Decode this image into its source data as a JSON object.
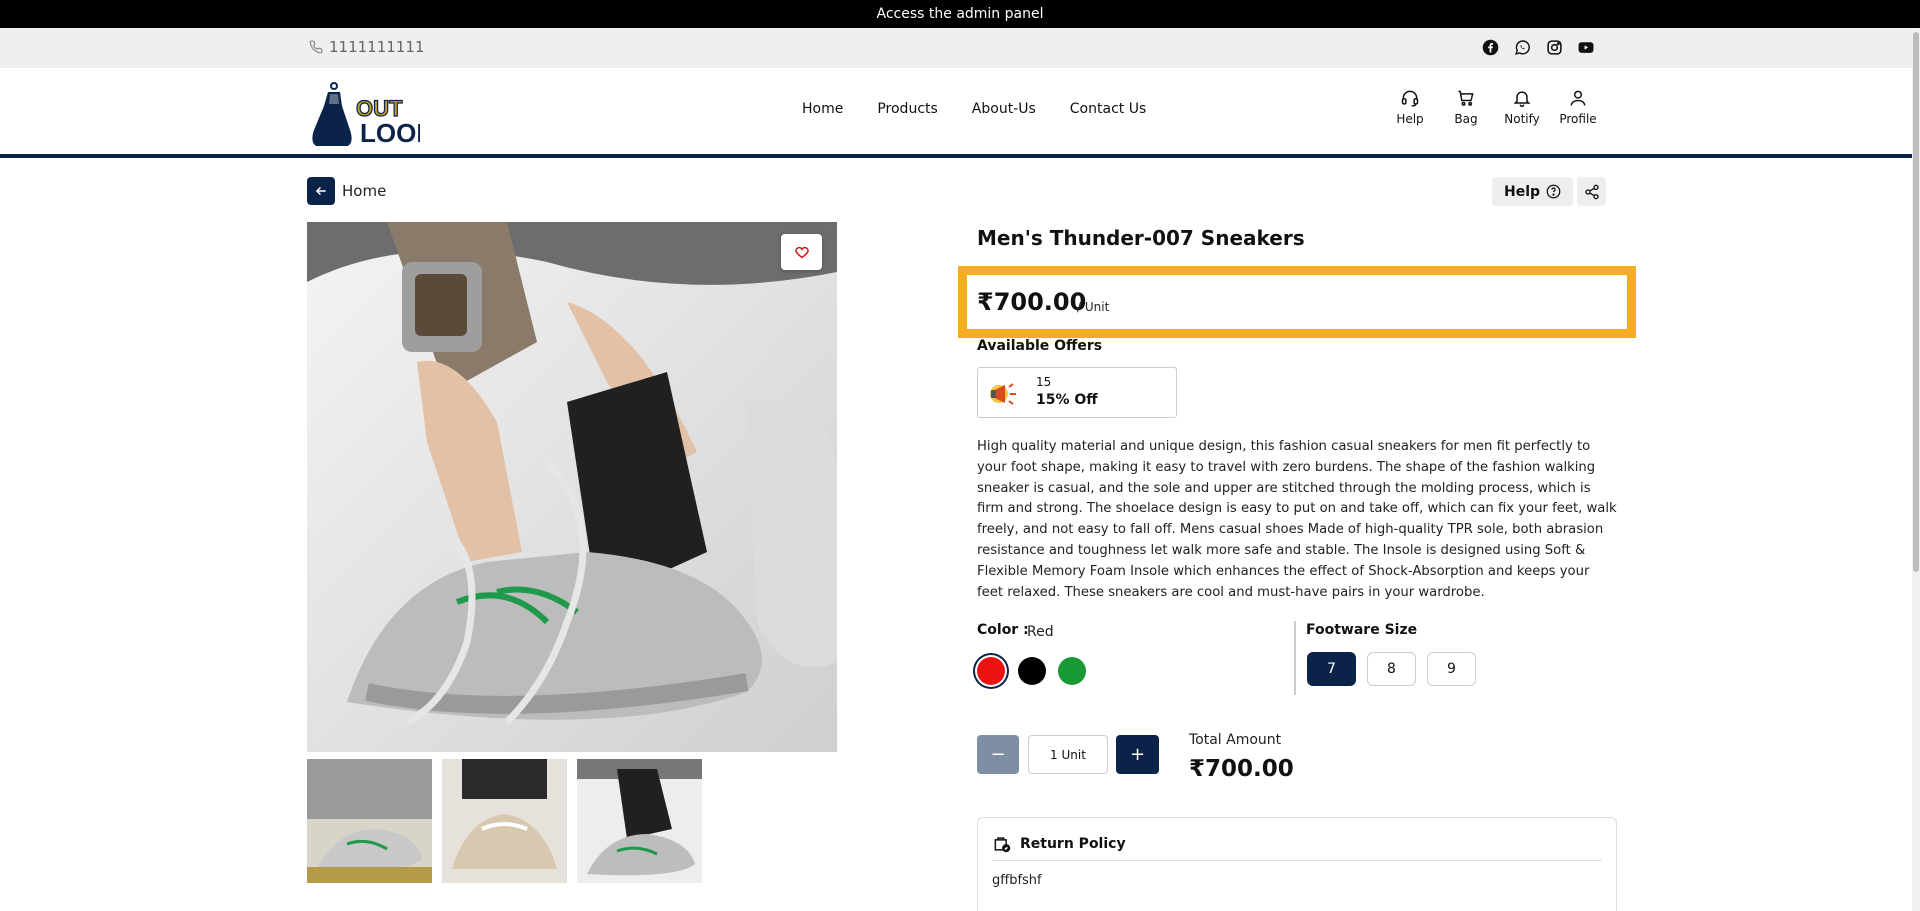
{
  "top_bar": {
    "admin_link": "Access the admin panel"
  },
  "contact_bar": {
    "phone": "1111111111",
    "socials": [
      "facebook-icon",
      "whatsapp-icon",
      "instagram-icon",
      "youtube-icon"
    ]
  },
  "header": {
    "logo_top": "OUT",
    "logo_bottom": "LOOK",
    "nav": [
      "Home",
      "Products",
      "About-Us",
      "Contact Us"
    ],
    "icons": [
      {
        "icon": "headset-icon",
        "label": "Help"
      },
      {
        "icon": "bag-icon",
        "label": "Bag"
      },
      {
        "icon": "bell-icon",
        "label": "Notify"
      },
      {
        "icon": "user-icon",
        "label": "Profile"
      }
    ]
  },
  "toolbar": {
    "back_label": "Home",
    "help_label": "Help"
  },
  "product": {
    "title": "Men's Thunder-007 Sneakers",
    "price": "₹700.00",
    "unit": "/ Unit",
    "offers_label": "Available Offers",
    "offer": {
      "code": "15",
      "title": "15% Off"
    },
    "description": "High quality material and unique design, this fashion casual sneakers for men fit perfectly to your foot shape, making it easy to travel with zero burdens. The shape of the fashion walking sneaker is casual, and the sole and upper are stitched through the molding process, which is firm and strong. The shoelace design is easy to put on and take off, which can fix your feet, walk freely, and not easy to fall off. Mens casual shoes Made of high-quality TPR sole, both abrasion resistance and toughness let walk more safe and stable. The Insole is designed using Soft & Flexible Memory Foam Insole which enhances the effect of Shock-Absorption and keeps your feet relaxed. These sneakers are cool and must-have pairs in your wardrobe.",
    "color_label": "Color :",
    "color_value": "Red",
    "colors": [
      "#ee1111",
      "#000000",
      "#1a9a35"
    ],
    "size_label": "Footware Size",
    "sizes": [
      "7",
      "8",
      "9"
    ],
    "selected_size": "7",
    "quantity": "1 Unit",
    "total_label": "Total Amount",
    "total_value": "₹700.00",
    "return_policy_title": "Return Policy",
    "return_policy_text": "gffbfshf"
  },
  "colors": {
    "navy": "#0b2349",
    "highlight": "#f4ac23"
  }
}
